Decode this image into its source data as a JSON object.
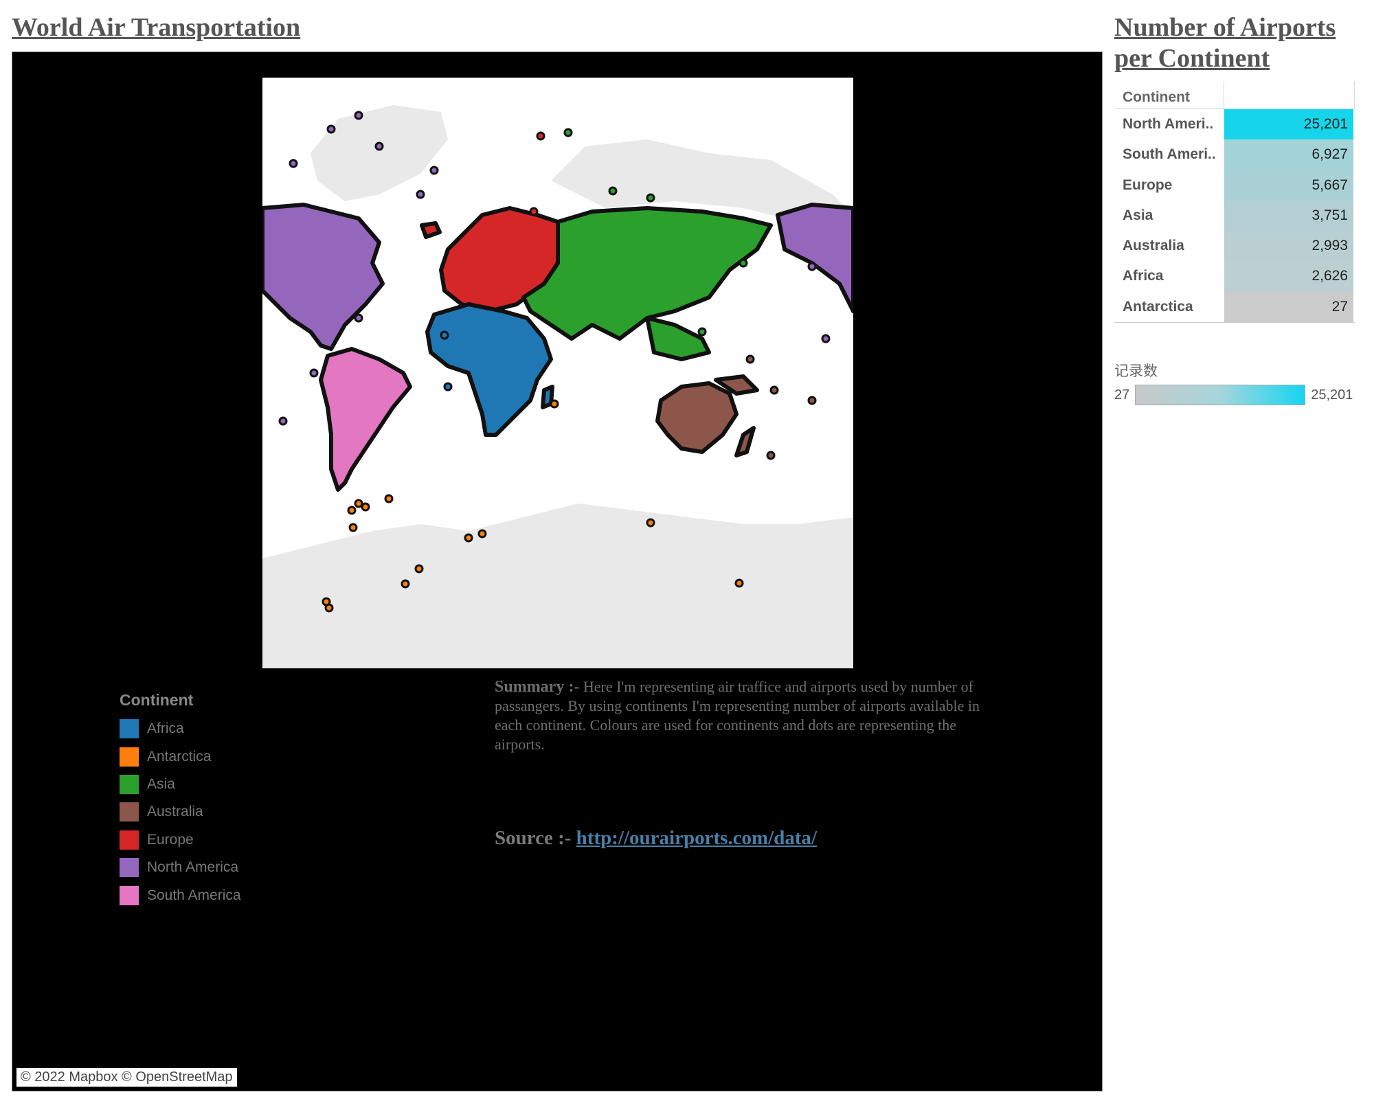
{
  "page": {
    "main_title": "World Air Transportation",
    "side_title": "Number of Airports per Continent"
  },
  "map": {
    "attribution": "© 2022 Mapbox © OpenStreetMap",
    "continent_colors": {
      "Africa": "#1f77b4",
      "Antarctica": "#ff7f0e",
      "Asia": "#2ca02c",
      "Australia": "#8c564b",
      "Europe": "#d62728",
      "North America": "#9467bd",
      "South America": "#e377c2"
    }
  },
  "legend": {
    "title": "Continent",
    "items": [
      {
        "label": "Africa",
        "color": "#1f77b4"
      },
      {
        "label": "Antarctica",
        "color": "#ff7f0e"
      },
      {
        "label": "Asia",
        "color": "#2ca02c"
      },
      {
        "label": "Australia",
        "color": "#8c564b"
      },
      {
        "label": "Europe",
        "color": "#d62728"
      },
      {
        "label": "North America",
        "color": "#9467bd"
      },
      {
        "label": "South America",
        "color": "#e377c2"
      }
    ]
  },
  "summary": {
    "label": "Summary :-",
    "text": " Here I'm representing air traffice and airports used by number of passangers. By using continents I'm representing number of airports available in each continent. Colours are used for continents  and dots are representing the airports."
  },
  "source": {
    "label": "Source :-",
    "link": "http://ourairports.com/data/"
  },
  "table": {
    "header": "Continent",
    "rows": [
      {
        "name": "North Ameri..",
        "value": "25,201",
        "color": "#16d5ea"
      },
      {
        "name": "South Ameri..",
        "value": "6,927",
        "color": "#a3d2d7"
      },
      {
        "name": "Europe",
        "value": "5,667",
        "color": "#a9d1d5"
      },
      {
        "name": "Asia",
        "value": "3,751",
        "color": "#b4cfd3"
      },
      {
        "name": "Australia",
        "value": "2,993",
        "color": "#bacfd2"
      },
      {
        "name": "Africa",
        "value": "2,626",
        "color": "#bccfd1"
      },
      {
        "name": "Antarctica",
        "value": "27",
        "color": "#cbcbcb"
      }
    ]
  },
  "color_legend": {
    "title": "记录数",
    "min": "27",
    "max": "25,201"
  }
}
